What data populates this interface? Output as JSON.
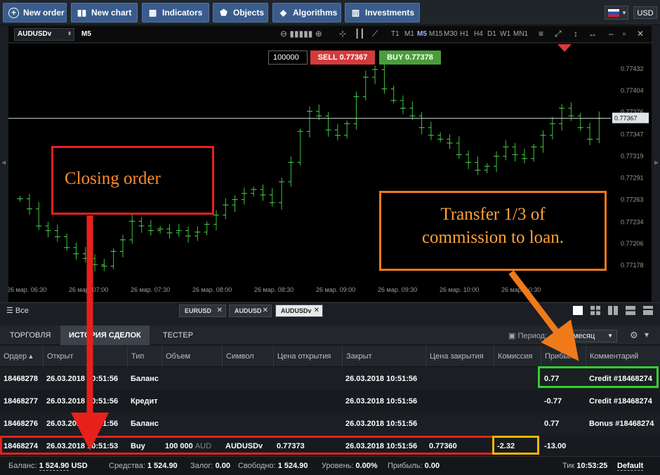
{
  "toolbar": {
    "buttons": [
      {
        "label": "New order",
        "icon": "plus-circle-icon"
      },
      {
        "label": "New chart",
        "icon": "candles-icon"
      },
      {
        "label": "Indicators",
        "icon": "indicators-icon"
      },
      {
        "label": "Objects",
        "icon": "objects-icon"
      },
      {
        "label": "Algorithms",
        "icon": "diamond-icon"
      },
      {
        "label": "Investments",
        "icon": "chart-bars-icon"
      }
    ],
    "language_flag": "flag-ru-icon",
    "currency": "USD"
  },
  "chart_toolbar": {
    "symbol": "AUDUSDv",
    "timeframe": "M5",
    "timeframes": [
      "T1",
      "M1",
      "M5",
      "M15",
      "M30",
      "H1",
      "H4",
      "D1",
      "W1",
      "MN1"
    ],
    "active_timeframe": "M5"
  },
  "trade": {
    "quantity": "100000",
    "sell_label": "SELL 0.77367",
    "buy_label": "BUY 0.77378"
  },
  "chart_data": {
    "type": "candlestick",
    "symbol": "AUDUSDv",
    "current_price": "0.77367",
    "y_ticks": [
      "0.77432",
      "0.77404",
      "0.77376",
      "0.77347",
      "0.77319",
      "0.77291",
      "0.77263",
      "0.77234",
      "0.77206",
      "0.77178"
    ],
    "x_ticks": [
      "26 мар. 06:30",
      "26 мар. 07:00",
      "26 мар. 07:30",
      "26 мар. 08:00",
      "26 мар. 08:30",
      "26 мар. 09:00",
      "26 мар. 09:30",
      "26 мар. 10:00",
      "26 мар. 10:30"
    ],
    "ylim": [
      0.7716,
      0.7745
    ],
    "candles_close": [
      0.77263,
      0.7725,
      0.77228,
      0.77222,
      0.77214,
      0.772,
      0.77192,
      0.77186,
      0.77178,
      0.77176,
      0.77195,
      0.7721,
      0.77234,
      0.77228,
      0.77222,
      0.77224,
      0.77219,
      0.77222,
      0.77215,
      0.7722,
      0.7723,
      0.77242,
      0.77255,
      0.77262,
      0.7727,
      0.77275,
      0.77268,
      0.77258,
      0.77285,
      0.7731,
      0.7735,
      0.77376,
      0.7737,
      0.77352,
      0.77345,
      0.7736,
      0.77395,
      0.7742,
      0.7743,
      0.77405,
      0.7739,
      0.7738,
      0.7737,
      0.77355,
      0.77345,
      0.7734,
      0.77335,
      0.7732,
      0.7731,
      0.773,
      0.77305,
      0.77318,
      0.7733,
      0.7732,
      0.77315,
      0.7733,
      0.77345,
      0.7736,
      0.7738,
      0.7737,
      0.77355,
      0.7734,
      0.77367
    ]
  },
  "annotations": {
    "closing_order": "Closing order",
    "transfer_line1": "Transfer 1/3 of",
    "transfer_line2": "commission to loan."
  },
  "tab_strip": {
    "all_label": "☰ Все",
    "tabs": [
      "EURUSD",
      "AUDUSD",
      "AUDUSDv"
    ],
    "active_tab": "AUDUSDv"
  },
  "panel": {
    "tabs": [
      "ТОРГОВЛЯ",
      "ИСТОРИЯ СДЕЛОК",
      "ТЕСТЕР"
    ],
    "active_tab": "ИСТОРИЯ СДЕЛОК",
    "period_label": "Период:",
    "period_value": "За месяц"
  },
  "table": {
    "columns": [
      "Ордер ▴",
      "Открыт",
      "Тип",
      "Объем",
      "Символ",
      "Цена открытия",
      "Закрыт",
      "Цена закрытия",
      "Комиссия",
      "Прибыль",
      "Комментарий"
    ],
    "rows": [
      [
        "18468278",
        "26.03.2018 10:51:56",
        "Баланс",
        "",
        "",
        "",
        "26.03.2018 10:51:56",
        "",
        "",
        "0.77",
        "Credit #18468274"
      ],
      [
        "18468277",
        "26.03.2018 10:51:56",
        "Кредит",
        "",
        "",
        "",
        "26.03.2018 10:51:56",
        "",
        "",
        "-0.77",
        "Credit #18468274"
      ],
      [
        "18468276",
        "26.03.2018 10:51:56",
        "Баланс",
        "",
        "",
        "",
        "26.03.2018 10:51:56",
        "",
        "",
        "0.77",
        "Bonus #18468274"
      ],
      [
        "18468274",
        "26.03.2018 10:51:53",
        "Buy",
        "100 000 AUD",
        "AUDUSDv",
        "0.77373",
        "26.03.2018 10:51:56",
        "0.77360",
        "-2.32",
        "-13.00",
        ""
      ]
    ]
  },
  "status": {
    "balance_label": "Баланс:",
    "balance": "1 524.90",
    "balance_ccy": "USD",
    "equity_label": "Средства:",
    "equity": "1 524.90",
    "margin_label": "Залог:",
    "margin": "0.00",
    "free_label": "Свободно:",
    "free": "1 524.90",
    "level_label": "Уровень:",
    "level": "0.00%",
    "profit_label": "Прибыль:",
    "profit": "0.00",
    "tick_label": "Тик",
    "tick_time": "10:53:25",
    "profile": "Default"
  }
}
